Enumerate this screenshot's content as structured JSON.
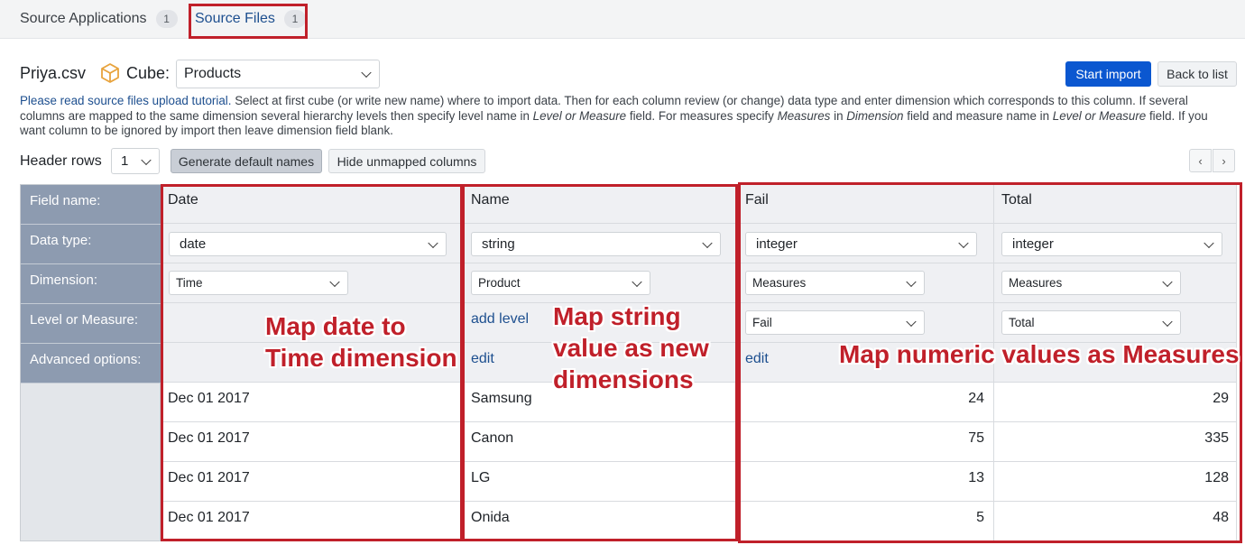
{
  "tabs": [
    {
      "label": "Source Applications",
      "count": "1"
    },
    {
      "label": "Source Files",
      "count": "1"
    }
  ],
  "file": {
    "name": "Priya.csv",
    "cube_label": "Cube:",
    "cube_value": "Products"
  },
  "actions": {
    "start_import": "Start import",
    "back_to_list": "Back to list"
  },
  "help": {
    "link": "Please read source files upload tutorial.",
    "t1": " Select at first cube (or write new name) where to import data. Then for each column review (or change) data type and enter dimension which corresponds to this column. If several columns are mapped to the same dimension several hierarchy levels then specify level name in ",
    "e1": "Level or Measure",
    "t2": " field. For measures specify ",
    "e2": "Measures",
    "t3": " in ",
    "e3": "Dimension",
    "t4": " field and measure name in ",
    "e4": "Level or Measure",
    "t5": " field. If you want column to be ignored by import then leave dimension field blank."
  },
  "toolbar": {
    "header_rows_label": "Header rows",
    "header_rows_value": "1",
    "generate_label": "Generate default names",
    "hide_label": "Hide unmapped columns",
    "prev": "‹",
    "next": "›"
  },
  "row_labels": [
    "Field name:",
    "Data type:",
    "Dimension:",
    "Level or Measure:",
    "Advanced options:"
  ],
  "columns": [
    {
      "field": "Date",
      "type": "date",
      "dimension": "Time",
      "level": "",
      "level_link": "",
      "advanced": "",
      "values": [
        "Dec 01 2017",
        "Dec 01 2017",
        "Dec 01 2017",
        "Dec 01 2017"
      ]
    },
    {
      "field": "Name",
      "type": "string",
      "dimension": "Product",
      "level": "",
      "level_link": "add level",
      "advanced": "edit",
      "values": [
        "Samsung",
        "Canon",
        "LG",
        "Onida"
      ]
    },
    {
      "field": "Fail",
      "type": "integer",
      "dimension": "Measures",
      "level": "Fail",
      "level_link": "",
      "advanced": "edit",
      "values": [
        "24",
        "75",
        "13",
        "5"
      ]
    },
    {
      "field": "Total",
      "type": "integer",
      "dimension": "Measures",
      "level": "Total",
      "level_link": "",
      "advanced": "",
      "values": [
        "29",
        "335",
        "128",
        "48"
      ]
    }
  ],
  "annotations": {
    "date": "Map date to\nTime dimension",
    "string": "Map string\nvalue as new\ndimensions",
    "numeric": "Map numeric values as Measures"
  },
  "colors": {
    "accent": "#0b57d0",
    "annotation": "#c0202a",
    "row_header": "#8d9bb0"
  }
}
